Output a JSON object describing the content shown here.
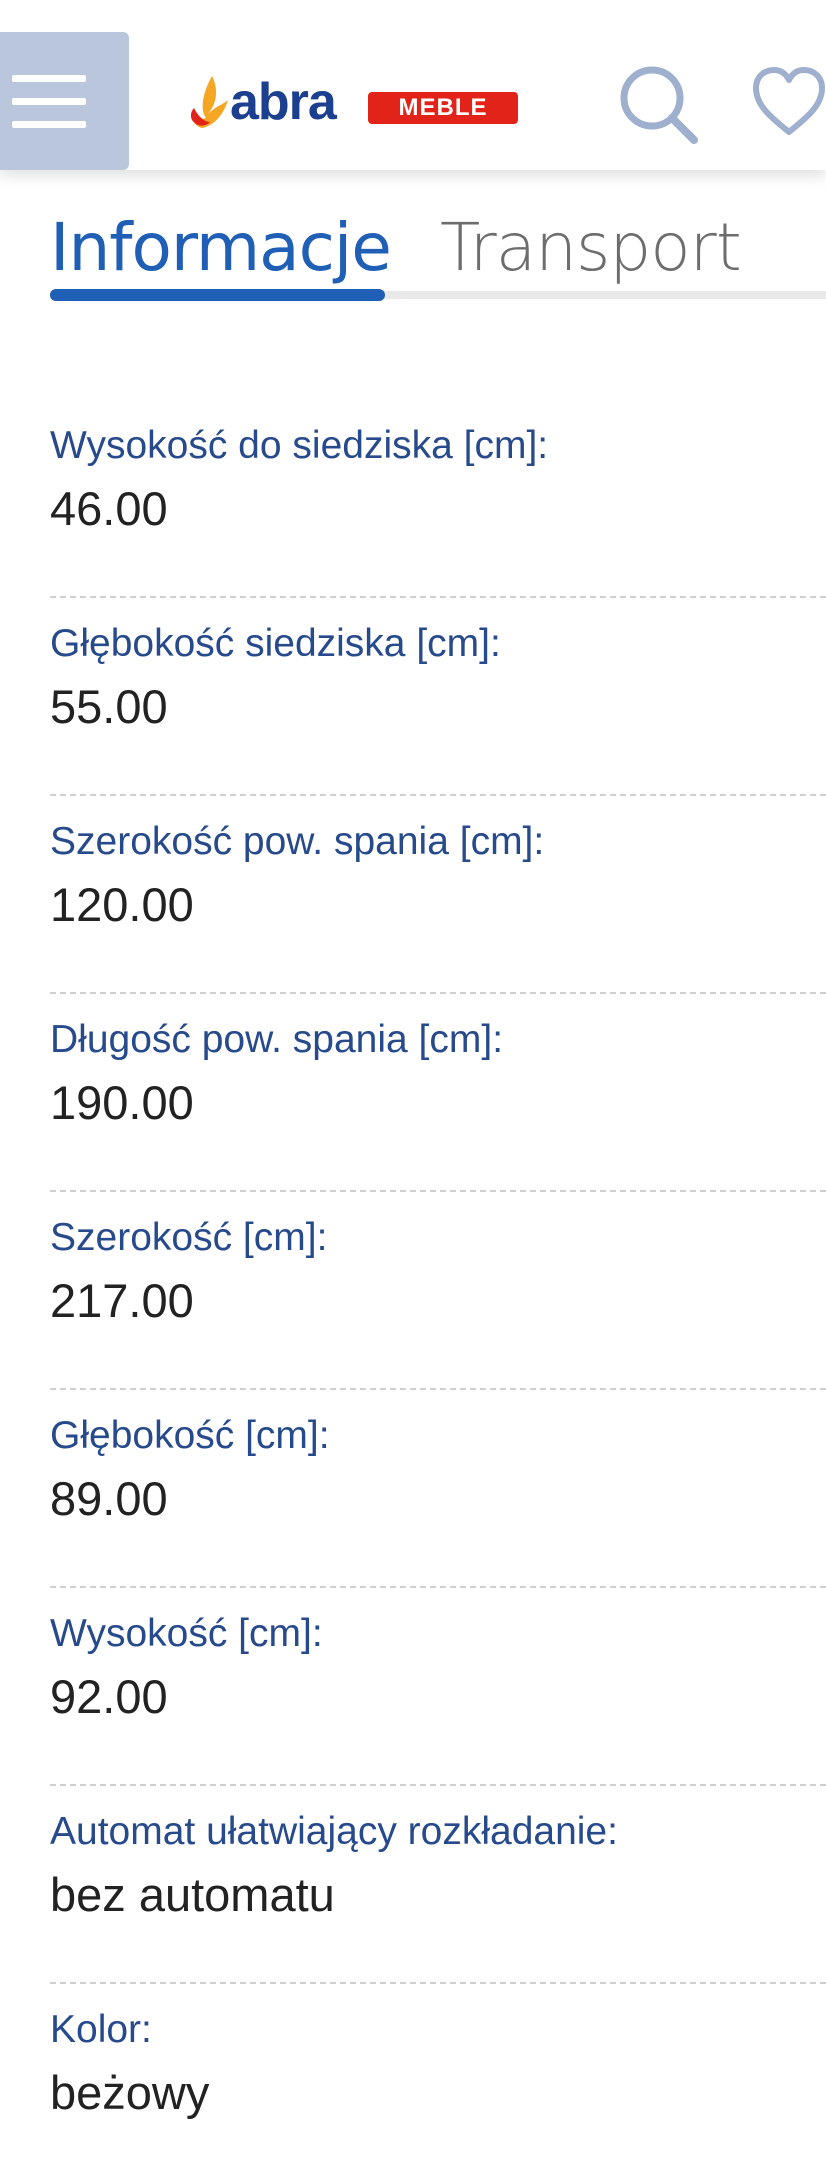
{
  "header": {
    "logo": {
      "word": "abra",
      "badge": "MEBLE",
      "brand_blue": "#1d3f8f",
      "brand_red": "#e2231a",
      "brand_yellow": "#f5a623"
    },
    "icons": {
      "menu": "hamburger-icon",
      "search": "search-icon",
      "favorites": "heart-icon"
    }
  },
  "tabs": [
    {
      "label": "Informacje",
      "active": true
    },
    {
      "label": "Transport",
      "active": false
    }
  ],
  "specs": [
    {
      "label": "Wysokość do siedziska [cm]:",
      "value": "46.00"
    },
    {
      "label": "Głębokość siedziska [cm]:",
      "value": "55.00"
    },
    {
      "label": "Szerokość pow. spania [cm]:",
      "value": "120.00"
    },
    {
      "label": "Długość pow. spania [cm]:",
      "value": "190.00"
    },
    {
      "label": "Szerokość [cm]:",
      "value": "217.00"
    },
    {
      "label": "Głębokość [cm]:",
      "value": "89.00"
    },
    {
      "label": "Wysokość [cm]:",
      "value": "92.00"
    },
    {
      "label": "Automat ułatwiający rozkładanie:",
      "value": "bez automatu"
    },
    {
      "label": "Kolor:",
      "value": "beżowy"
    }
  ],
  "colors": {
    "accent": "#1f5fb5",
    "label": "#274a8c",
    "menu_bg": "#b9c6dc"
  }
}
